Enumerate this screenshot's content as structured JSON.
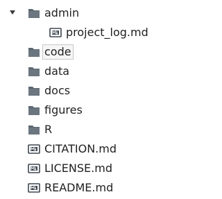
{
  "tree": {
    "items": [
      {
        "label": "admin",
        "icon": "folder-icon",
        "expanded": true
      },
      {
        "label": "project_log.md",
        "icon": "markdown-file-icon"
      },
      {
        "label": "code",
        "icon": "folder-icon",
        "selected": true
      },
      {
        "label": "data",
        "icon": "folder-icon"
      },
      {
        "label": "docs",
        "icon": "folder-icon"
      },
      {
        "label": "figures",
        "icon": "folder-icon"
      },
      {
        "label": "R",
        "icon": "folder-icon"
      },
      {
        "label": "CITATION.md",
        "icon": "markdown-file-icon"
      },
      {
        "label": "LICENSE.md",
        "icon": "markdown-file-icon"
      },
      {
        "label": "README.md",
        "icon": "markdown-file-icon"
      }
    ]
  },
  "colors": {
    "folder": "#5c6770",
    "file_border": "#3d4650",
    "text": "#1f1f1f"
  }
}
